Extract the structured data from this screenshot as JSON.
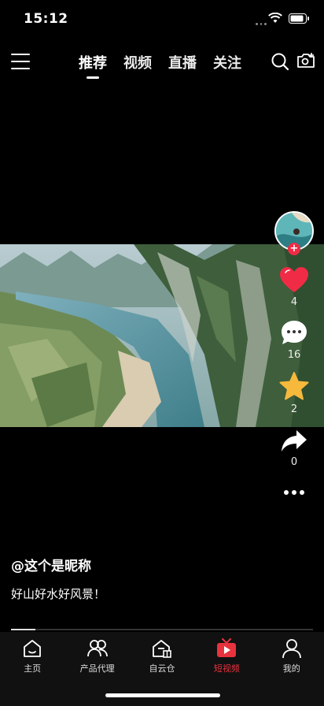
{
  "status": {
    "time": "15:12"
  },
  "top_nav": {
    "tabs": [
      {
        "label": "推荐",
        "active": true
      },
      {
        "label": "视频",
        "active": false
      },
      {
        "label": "直播",
        "active": false
      },
      {
        "label": "关注",
        "active": false
      }
    ]
  },
  "side_actions": {
    "like_count": "4",
    "comment_count": "16",
    "favorite_count": "2",
    "share_count": "0"
  },
  "caption": {
    "nickname": "@这个是昵称",
    "description": "好山好水好风景！"
  },
  "progress": {
    "fraction": 0.08
  },
  "bottom_nav": {
    "items": [
      {
        "label": "主页",
        "icon": "home-icon",
        "active": false
      },
      {
        "label": "产品代理",
        "icon": "users-icon",
        "active": false
      },
      {
        "label": "自云仓",
        "icon": "warehouse-icon",
        "active": false
      },
      {
        "label": "短视频",
        "icon": "tv-icon",
        "active": true
      },
      {
        "label": "我的",
        "icon": "person-icon",
        "active": false
      }
    ]
  },
  "colors": {
    "accent": "#e8333f",
    "like": "#f02b45",
    "favorite": "#f6b93b"
  }
}
